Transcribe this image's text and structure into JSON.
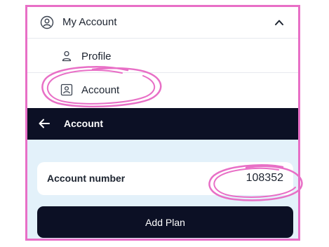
{
  "menu": {
    "header_label": "My Account",
    "header_icon": "user-circle-icon",
    "header_chevron": "chevron-up-icon",
    "items": [
      {
        "label": "Profile",
        "icon": "person-icon"
      },
      {
        "label": "Account",
        "icon": "account-card-icon"
      }
    ]
  },
  "header": {
    "title": "Account",
    "back_icon": "arrow-left-icon"
  },
  "account": {
    "number_label": "Account number",
    "number_value": "108352"
  },
  "actions": {
    "add_plan_label": "Add Plan"
  },
  "colors": {
    "dark": "#0c1025",
    "content_bg": "#e3f1fa",
    "highlight": "#e86fc6"
  }
}
